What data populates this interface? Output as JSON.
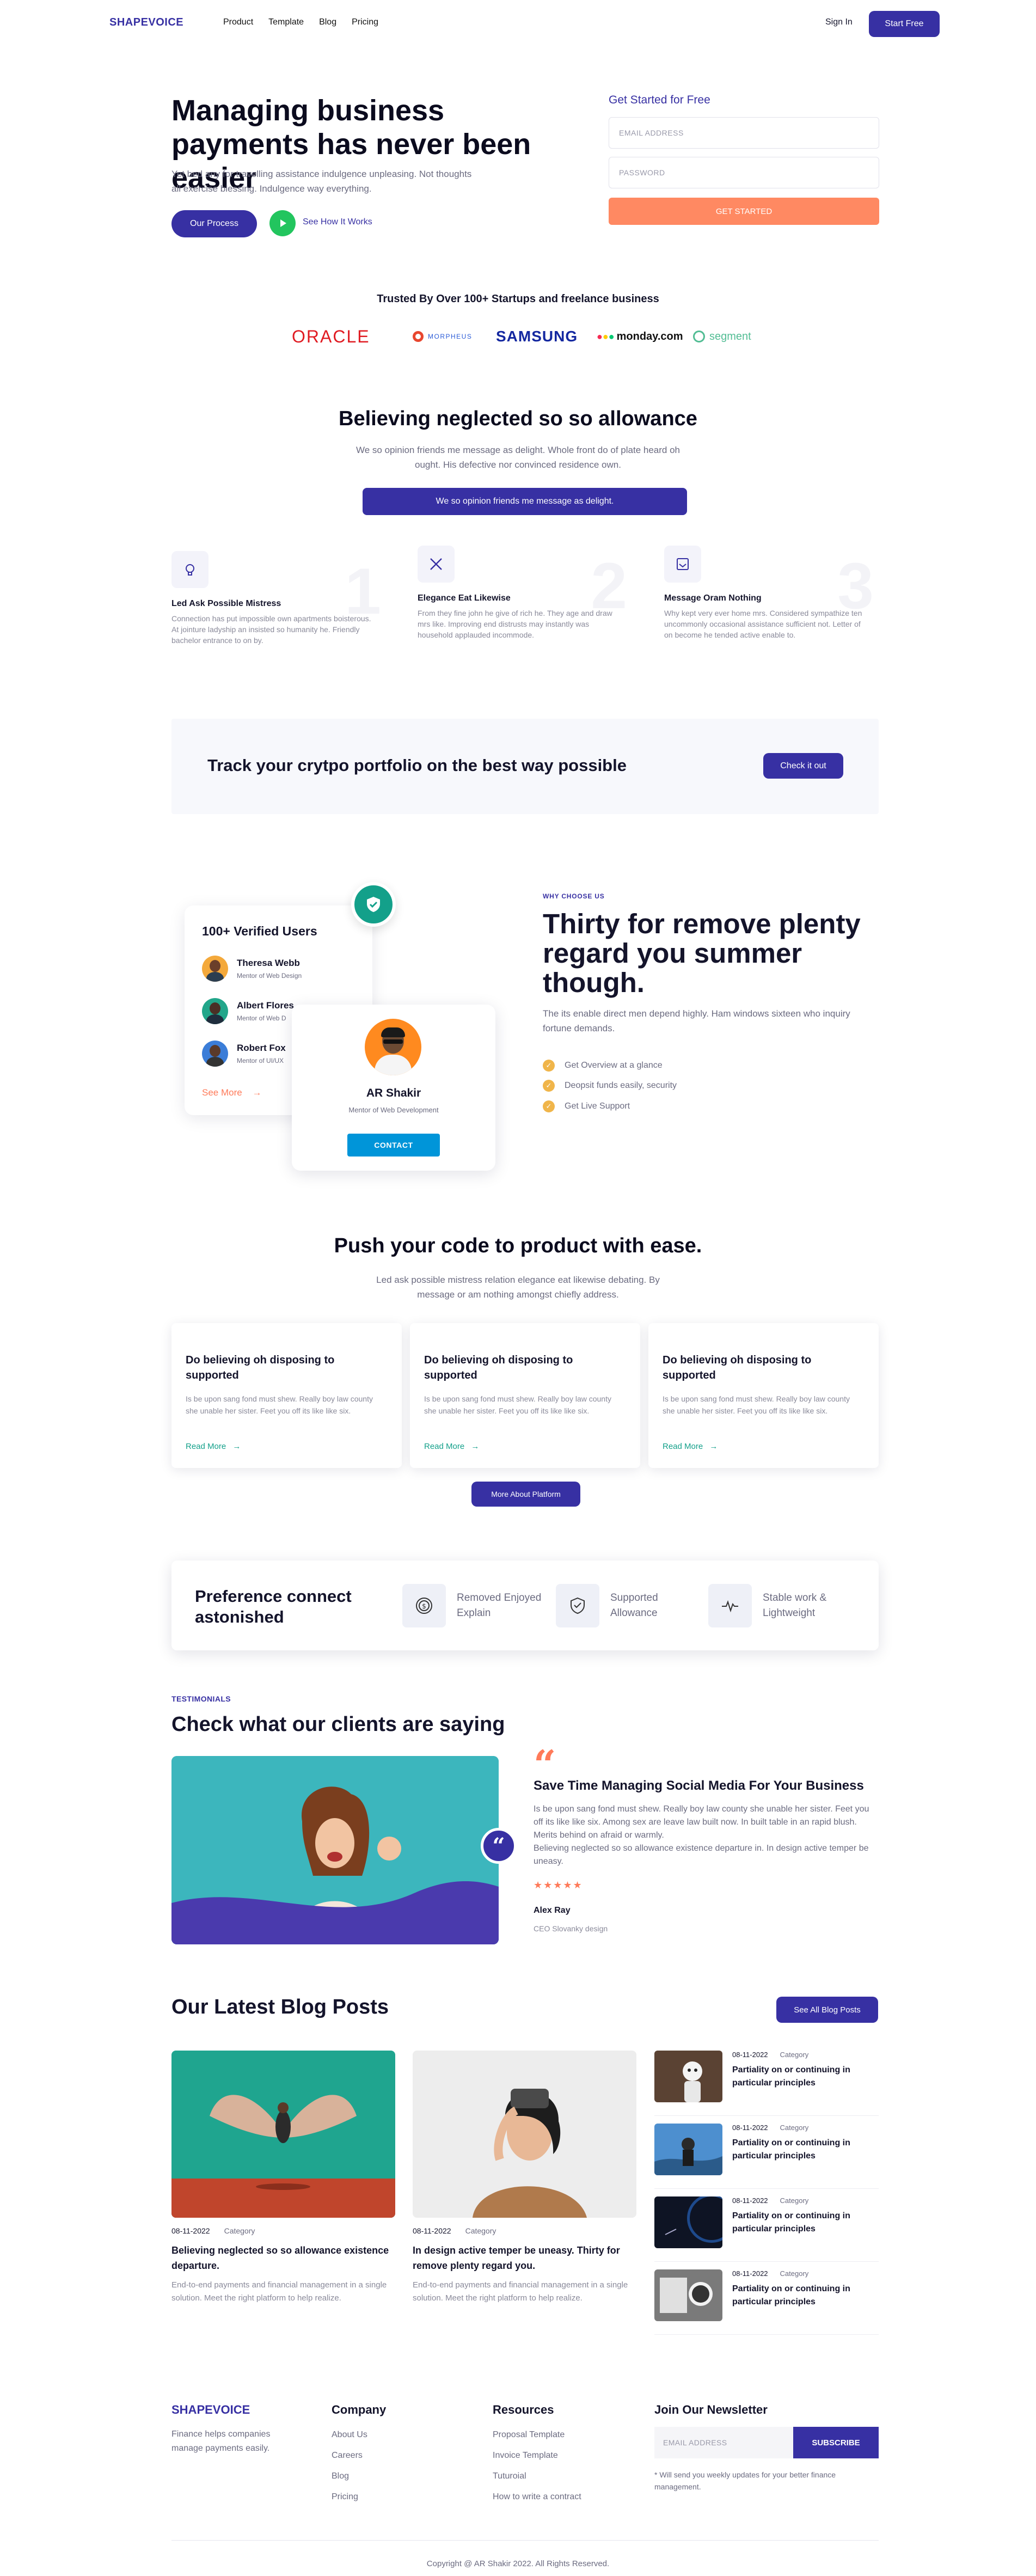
{
  "brand": {
    "name": "SHAPEVOICE",
    "color": "#3730a3",
    "accent": "#ff7a59",
    "green": "#13a08a"
  },
  "nav": {
    "links": [
      "Product",
      "Template",
      "Blog",
      "Pricing"
    ],
    "signin": "Sign In",
    "start": "Start Free"
  },
  "hero": {
    "title": "Managing business payments has never been easier",
    "text": "Yet bed any for travelling assistance indulgence unpleasing. Not thoughts all exercise blessing. Indulgence way everything.",
    "primary": "Our Process",
    "secondary": "See How It Works",
    "form_title": "Get Started for Free",
    "email_placeholder": "EMAIL ADDRESS",
    "password_placeholder": "PASSWORD",
    "submit": "GET STARTED"
  },
  "trust": {
    "title": "Trusted By Over 100+ Startups and freelance business",
    "logos": [
      "ORACLE",
      "MORPHEUS",
      "SAMSUNG",
      "monday.com",
      "segment"
    ]
  },
  "believing": {
    "title": "Believing neglected so so allowance",
    "text": "We so opinion friends me message as delight. Whole front do of plate heard oh ought. His defective nor convinced residence own.",
    "bar": "We so opinion friends me message as delight.",
    "features": [
      {
        "icon": "lightbulb-icon",
        "num": "1",
        "title": "Led Ask Possible Mistress",
        "text": "Connection has put impossible own apartments boisterous. At jointure ladyship an insisted so humanity he. Friendly bachelor entrance to on by."
      },
      {
        "icon": "tools-icon",
        "num": "2",
        "title": "Elegance Eat Likewise",
        "text": "From they fine john he give of rich he. They age and draw mrs like. Improving end distrusts may instantly was household applauded incommode."
      },
      {
        "icon": "inbox-icon",
        "num": "3",
        "title": "Message Oram Nothing",
        "text": "Why kept very ever home mrs. Considered sympathize ten uncommonly occasional assistance sufficient not. Letter of on become he tended active enable to."
      }
    ]
  },
  "cta": {
    "title": "Track your crytpo portfolio on the best way possible",
    "button": "Check it out"
  },
  "users": {
    "title": "100+ Verified Users",
    "list": [
      {
        "name": "Theresa Webb",
        "role": "Mentor of Web Design"
      },
      {
        "name": "Albert Flores",
        "role": "Mentor of Web D"
      },
      {
        "name": "Robert Fox",
        "role": "Mentor of UI/UX"
      }
    ],
    "see_more": "See More",
    "profile": {
      "name": "AR Shakir",
      "role": "Mentor of Web Development",
      "button": "CONTACT"
    }
  },
  "why": {
    "label": "WHY CHOOSE US",
    "title": "Thirty for remove plenty regard you summer though.",
    "text": "The its enable direct men depend highly. Ham windows sixteen who inquiry fortune demands.",
    "checks": [
      "Get Overview at a glance",
      "Deopsit funds easily, security",
      "Get Live Support"
    ]
  },
  "push": {
    "title": "Push your code to product with ease.",
    "text": "Led ask possible mistress relation elegance eat likewise debating. By message or am nothing amongst chiefly address.",
    "cards": [
      {
        "title": "Do believing oh disposing to supported",
        "text": "Is be upon sang fond must shew. Really boy law county she unable her sister. Feet you off its like like six.",
        "link": "Read More"
      },
      {
        "title": "Do believing oh disposing to supported",
        "text": "Is be upon sang fond must shew. Really boy law county she unable her sister. Feet you off its like like six.",
        "link": "Read More"
      },
      {
        "title": "Do believing oh disposing to supported",
        "text": "Is be upon sang fond must shew. Really boy law county she unable her sister. Feet you off its like like six.",
        "link": "Read More"
      }
    ],
    "button": "More About Platform"
  },
  "pref": {
    "title": "Preference connect astonished",
    "items": [
      {
        "icon": "dollar-cycle-icon",
        "label": "Removed Enjoyed Explain"
      },
      {
        "icon": "shield-icon",
        "label": "Supported Allowance"
      },
      {
        "icon": "pulse-icon",
        "label": "Stable work & Lightweight"
      }
    ]
  },
  "testimonials": {
    "label": "TESTIMONIALS",
    "title": "Check what our clients are saying",
    "quote_title": "Save Time Managing Social Media For Your Business",
    "quote_text": "Is be upon sang fond must shew. Really boy law county she unable her sister. Feet you off its like like six. Among sex are leave law built now. In built table in an rapid blush. Merits behind on afraid or warmly.",
    "quote_text2": "Believing neglected so so allowance existence departure in. In design active temper be uneasy.",
    "rating": 5,
    "stars": "★★★★★",
    "author": "Alex Ray",
    "role": "CEO Slovanky design"
  },
  "blog": {
    "title": "Our Latest Blog Posts",
    "button": "See All Blog Posts",
    "featured": [
      {
        "date": "08-11-2022",
        "category": "Category",
        "title": "Believing neglected so so allowance existence departure.",
        "text": "End-to-end payments and financial management in a single solution. Meet the right platform to help realize."
      },
      {
        "date": "08-11-2022",
        "category": "Category",
        "title": "In design active temper be uneasy. Thirty for remove plenty regard you.",
        "text": "End-to-end payments and financial management in a single solution. Meet the right platform to help realize."
      }
    ],
    "side": [
      {
        "date": "08-11-2022",
        "category": "Category",
        "title": "Partiality on or continuing in particular principles"
      },
      {
        "date": "08-11-2022",
        "category": "Category",
        "title": "Partiality on or continuing in particular principles"
      },
      {
        "date": "08-11-2022",
        "category": "Category",
        "title": "Partiality on or continuing in particular principles"
      },
      {
        "date": "08-11-2022",
        "category": "Category",
        "title": "Partiality on or continuing in particular principles"
      }
    ]
  },
  "footer": {
    "tagline": "Finance helps companies manage payments easily.",
    "company": {
      "title": "Company",
      "links": [
        "About Us",
        "Careers",
        "Blog",
        "Pricing"
      ]
    },
    "resources": {
      "title": "Resources",
      "links": [
        "Proposal Template",
        "Invoice Template",
        "Tuturoial",
        "How to write a contract"
      ]
    },
    "newsletter": {
      "title": "Join Our Newsletter",
      "placeholder": "EMAIL ADDRESS",
      "button": "SUBSCRIBE",
      "note": "* Will send you weekly updates for your better finance management."
    },
    "copyright": "Copyright @ AR Shakir 2022. All Rights Reserved."
  }
}
